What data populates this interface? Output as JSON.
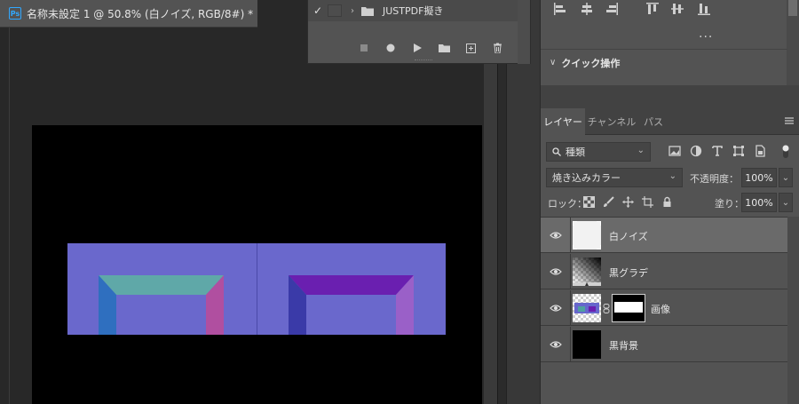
{
  "document": {
    "tab_title": "名称未設定 1 @ 50.8% (白ノイズ, RGB/8#) *",
    "app_icon_label": "Ps"
  },
  "actions_panel": {
    "row": {
      "checked": true,
      "name": "JUSTPDF擬き",
      "icon": "folder-icon"
    },
    "toolbar": [
      "stop-icon",
      "record-icon",
      "play-icon",
      "folder-icon",
      "new-action-icon",
      "trash-icon"
    ]
  },
  "align_panel": {
    "icons": [
      "align-left-icon",
      "align-hcenter-icon",
      "align-right-icon",
      "align-top-icon",
      "align-vcenter-icon",
      "align-bottom-icon"
    ],
    "more_label": "..."
  },
  "quick_actions": {
    "title": "クイック操作"
  },
  "layers_panel": {
    "tabs": [
      {
        "label": "レイヤー",
        "active": true
      },
      {
        "label": "チャンネル",
        "active": false
      },
      {
        "label": "パス",
        "active": false
      }
    ],
    "filter": {
      "label": "種類",
      "icons": [
        "image-filter-icon",
        "adjustment-filter-icon",
        "type-filter-icon",
        "shape-filter-icon",
        "smart-object-filter-icon"
      ]
    },
    "blend_mode": "焼き込みカラー",
    "opacity_label": "不透明度：",
    "opacity_value": "100%",
    "lock_label": "ロック：",
    "lock_icons": [
      "lock-transparency-icon",
      "lock-paint-icon",
      "lock-position-icon",
      "lock-artboard-icon",
      "lock-all-icon"
    ],
    "fill_label": "塗り：",
    "fill_value": "100%",
    "layers": [
      {
        "name": "白ノイズ",
        "visible": true,
        "selected": true,
        "thumb": "white"
      },
      {
        "name": "黒グラデ",
        "visible": true,
        "selected": false,
        "thumb": "gradient"
      },
      {
        "name": "画像",
        "visible": true,
        "selected": false,
        "thumb": "image-with-mask"
      },
      {
        "name": "黒背景",
        "visible": true,
        "selected": false,
        "thumb": "black"
      }
    ]
  },
  "colors": {
    "panel_bg": "#535353",
    "canvas_bg": "#282828",
    "selected_layer": "#6a6a6a",
    "image_blue": "#6666cc"
  }
}
